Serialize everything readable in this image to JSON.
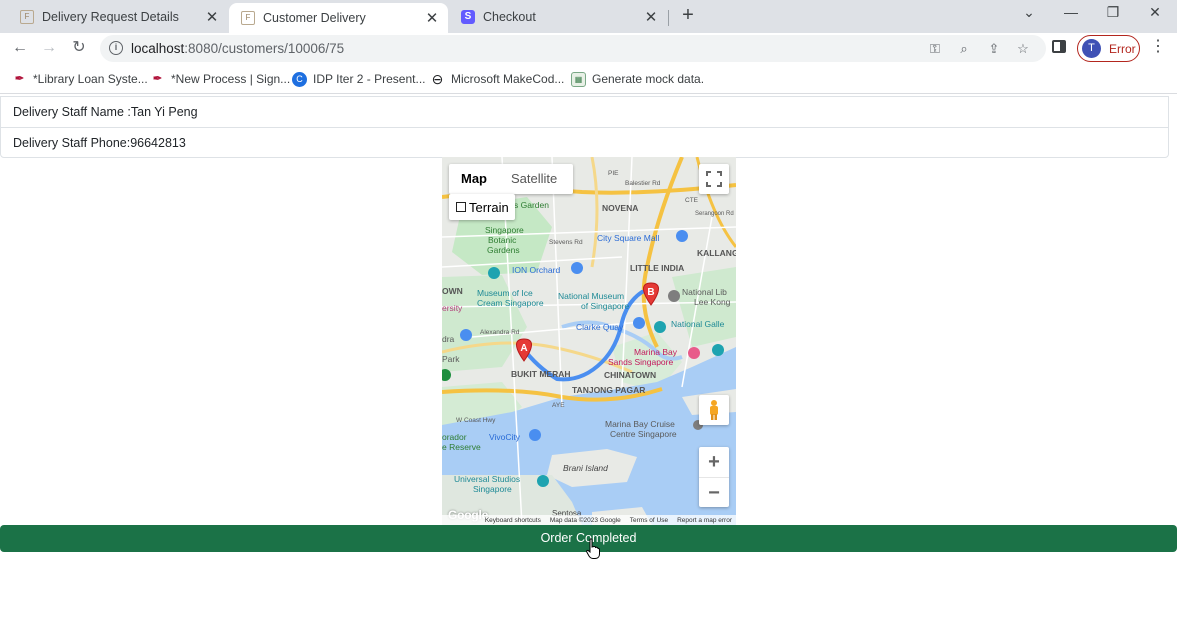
{
  "browser": {
    "tabs": [
      {
        "title": "Delivery Request Details",
        "favicon": "form-icon",
        "active": false
      },
      {
        "title": "Customer Delivery",
        "favicon": "form-icon",
        "active": true
      },
      {
        "title": "Checkout",
        "favicon": "stripe-icon",
        "active": false
      }
    ],
    "url_host": "localhost",
    "url_path": ":8080/customers/10006/75",
    "profile": {
      "initial": "T",
      "label": "Error",
      "color": "#b3261e"
    },
    "bookmarks": [
      {
        "label": "*Library Loan Syste...",
        "icon": "pen-icon"
      },
      {
        "label": "*New Process | Sign...",
        "icon": "pen-icon"
      },
      {
        "label": "IDP Iter 2 - Present...",
        "icon": "canva-icon"
      },
      {
        "label": "Microsoft MakeCod...",
        "icon": "link-icon"
      },
      {
        "label": "Generate mock data.",
        "icon": "mock-icon"
      }
    ]
  },
  "page": {
    "staff_name": "Delivery Staff Name :Tan Yi Peng",
    "staff_phone": "Delivery Staff Phone:96642813",
    "order_button": "Order Completed"
  },
  "map": {
    "type_map": "Map",
    "type_satellite": "Satellite",
    "terrain": "Terrain",
    "marker_a": "A",
    "marker_b": "B",
    "footer": [
      "Keyboard shortcuts",
      "Map data ©2023 Google",
      "Terms of Use",
      "Report a map error"
    ],
    "logo": "Google",
    "labels": {
      "balestier": "Balestier Rd",
      "pie": "PIE",
      "novena": "NOVENA",
      "cte": "CTE",
      "serangoon": "Serangoon Rd",
      "garden": "s Garden",
      "botanic1": "Singapore",
      "botanic2": "Botanic",
      "botanic3": "Gardens",
      "stevens": "Stevens Rd",
      "citysquare": "City Square Mall",
      "kallang": "KALLANG",
      "ion": "ION Orchard",
      "littleindia": "LITTLE INDIA",
      "own": "OWN",
      "museum1": "Museum of Ice",
      "museum2": "Cream Singapore",
      "natmuseum1": "National Museum",
      "natmuseum2": "of Singapore",
      "natlib1": "National Lib",
      "natlib2": "Lee Kong",
      "ersity": "ersity",
      "alexandra": "Alexandra Rd",
      "clarkequay": "Clarke Quay",
      "natgallery": "National Galle",
      "dra": "dra",
      "park": "Park",
      "marinabay1": "Marina Bay",
      "marinabay2": "Sands Singapore",
      "bukitmerah": "BUKIT MERAH",
      "chinatown": "CHINATOWN",
      "tanjongpagar": "TANJONG PAGAR",
      "ayer": "AYE",
      "wcoast": "W Coast Hwy",
      "cruise1": "Marina Bay Cruise",
      "cruise2": "Centre Singapore",
      "vivocity": "VivoCity",
      "orador": "orador",
      "reserve": "e Reserve",
      "brani": "Brani Island",
      "universal1": "Universal Studios",
      "universal2": "Singapore",
      "sentosa": "Sentosa"
    }
  }
}
